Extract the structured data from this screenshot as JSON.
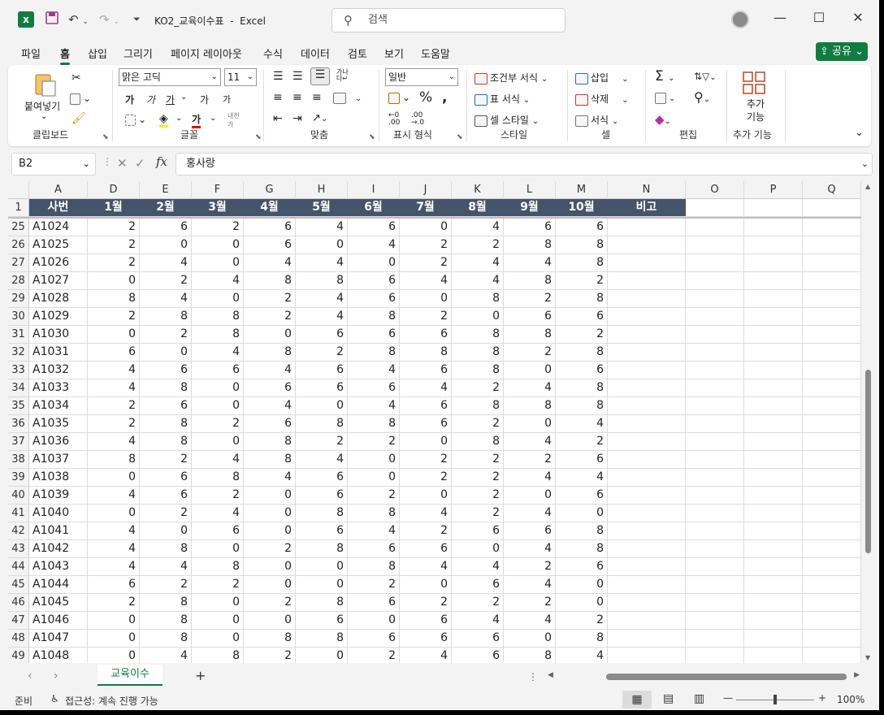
{
  "title_bar": {
    "filename": "KO2_교육이수표",
    "app": "Excel",
    "separator": "-",
    "search_placeholder": "검색"
  },
  "menu_tabs": [
    "파일",
    "홈",
    "삽입",
    "그리기",
    "페이지 레이아웃",
    "수식",
    "데이터",
    "검토",
    "보기",
    "도움말"
  ],
  "active_tab": "홈",
  "share_label": "공유",
  "ribbon": {
    "clipboard": {
      "paste": "붙여넣기",
      "label": "클립보드"
    },
    "font": {
      "name": "맑은 고딕",
      "size": "11",
      "label": "글꼴",
      "bold": "가",
      "italic": "가",
      "underline": "가",
      "grow": "가",
      "shrink": "가",
      "color_letter": "가"
    },
    "alignment": {
      "label": "맞춤"
    },
    "number": {
      "format": "일반",
      "label": "표시 형식"
    },
    "styles": {
      "conditional": "조건부 서식",
      "table": "표 서식",
      "cell": "셀 스타일",
      "label": "스타일"
    },
    "cells": {
      "insert": "삽입",
      "delete": "삭제",
      "format": "서식",
      "label": "셀"
    },
    "editing": {
      "label": "편집"
    },
    "addins": {
      "button": "추가 기능",
      "label": "추가 기능"
    }
  },
  "formula_bar": {
    "name_box": "B2",
    "fx": "fx",
    "value": "홍사랑"
  },
  "columns": [
    "A",
    "D",
    "E",
    "F",
    "G",
    "H",
    "I",
    "J",
    "K",
    "L",
    "M",
    "N",
    "O",
    "P",
    "Q"
  ],
  "header_row": {
    "num": "1",
    "cells": [
      "사번",
      "1월",
      "2월",
      "3월",
      "4월",
      "5월",
      "6월",
      "7월",
      "8월",
      "9월",
      "10월",
      "비고"
    ]
  },
  "rows": [
    {
      "num": "25",
      "id": "A1024",
      "v": [
        "2",
        "6",
        "2",
        "6",
        "4",
        "6",
        "0",
        "4",
        "6",
        "6"
      ]
    },
    {
      "num": "26",
      "id": "A1025",
      "v": [
        "2",
        "0",
        "0",
        "6",
        "0",
        "4",
        "2",
        "2",
        "8",
        "8"
      ]
    },
    {
      "num": "27",
      "id": "A1026",
      "v": [
        "2",
        "4",
        "0",
        "4",
        "4",
        "0",
        "2",
        "4",
        "4",
        "8"
      ]
    },
    {
      "num": "28",
      "id": "A1027",
      "v": [
        "0",
        "2",
        "4",
        "8",
        "8",
        "6",
        "4",
        "4",
        "8",
        "2"
      ]
    },
    {
      "num": "29",
      "id": "A1028",
      "v": [
        "8",
        "4",
        "0",
        "2",
        "4",
        "6",
        "0",
        "8",
        "2",
        "8"
      ]
    },
    {
      "num": "30",
      "id": "A1029",
      "v": [
        "2",
        "8",
        "8",
        "2",
        "4",
        "8",
        "2",
        "0",
        "6",
        "6"
      ]
    },
    {
      "num": "31",
      "id": "A1030",
      "v": [
        "0",
        "2",
        "8",
        "0",
        "6",
        "6",
        "6",
        "8",
        "8",
        "2"
      ]
    },
    {
      "num": "32",
      "id": "A1031",
      "v": [
        "6",
        "0",
        "4",
        "8",
        "2",
        "8",
        "8",
        "8",
        "2",
        "8"
      ]
    },
    {
      "num": "33",
      "id": "A1032",
      "v": [
        "4",
        "6",
        "6",
        "4",
        "6",
        "4",
        "6",
        "8",
        "0",
        "6"
      ]
    },
    {
      "num": "34",
      "id": "A1033",
      "v": [
        "4",
        "8",
        "0",
        "6",
        "6",
        "6",
        "4",
        "2",
        "4",
        "8"
      ]
    },
    {
      "num": "35",
      "id": "A1034",
      "v": [
        "2",
        "6",
        "0",
        "4",
        "0",
        "4",
        "6",
        "8",
        "8",
        "8"
      ]
    },
    {
      "num": "36",
      "id": "A1035",
      "v": [
        "2",
        "8",
        "2",
        "6",
        "8",
        "8",
        "6",
        "2",
        "0",
        "4"
      ]
    },
    {
      "num": "37",
      "id": "A1036",
      "v": [
        "4",
        "8",
        "0",
        "8",
        "2",
        "2",
        "0",
        "8",
        "4",
        "2"
      ]
    },
    {
      "num": "38",
      "id": "A1037",
      "v": [
        "8",
        "2",
        "4",
        "8",
        "4",
        "0",
        "2",
        "2",
        "2",
        "6"
      ]
    },
    {
      "num": "39",
      "id": "A1038",
      "v": [
        "0",
        "6",
        "8",
        "4",
        "6",
        "0",
        "2",
        "2",
        "4",
        "4"
      ]
    },
    {
      "num": "40",
      "id": "A1039",
      "v": [
        "4",
        "6",
        "2",
        "0",
        "6",
        "2",
        "0",
        "2",
        "0",
        "6"
      ]
    },
    {
      "num": "41",
      "id": "A1040",
      "v": [
        "0",
        "2",
        "4",
        "0",
        "8",
        "8",
        "4",
        "2",
        "4",
        "0"
      ]
    },
    {
      "num": "42",
      "id": "A1041",
      "v": [
        "4",
        "0",
        "6",
        "0",
        "6",
        "4",
        "2",
        "6",
        "6",
        "8"
      ]
    },
    {
      "num": "43",
      "id": "A1042",
      "v": [
        "4",
        "8",
        "0",
        "2",
        "8",
        "6",
        "6",
        "0",
        "4",
        "8"
      ]
    },
    {
      "num": "44",
      "id": "A1043",
      "v": [
        "4",
        "4",
        "8",
        "0",
        "0",
        "8",
        "4",
        "4",
        "2",
        "6"
      ]
    },
    {
      "num": "45",
      "id": "A1044",
      "v": [
        "6",
        "2",
        "2",
        "0",
        "0",
        "2",
        "0",
        "6",
        "4",
        "0"
      ]
    },
    {
      "num": "46",
      "id": "A1045",
      "v": [
        "2",
        "8",
        "0",
        "2",
        "8",
        "6",
        "2",
        "2",
        "2",
        "0"
      ]
    },
    {
      "num": "47",
      "id": "A1046",
      "v": [
        "0",
        "8",
        "0",
        "0",
        "6",
        "0",
        "6",
        "4",
        "4",
        "2"
      ]
    },
    {
      "num": "48",
      "id": "A1047",
      "v": [
        "0",
        "8",
        "0",
        "8",
        "8",
        "6",
        "6",
        "6",
        "0",
        "8"
      ]
    },
    {
      "num": "49",
      "id": "A1048",
      "v": [
        "0",
        "4",
        "8",
        "2",
        "0",
        "2",
        "4",
        "6",
        "8",
        "4"
      ]
    }
  ],
  "sheet_tab": "교육이수",
  "status": {
    "ready": "준비",
    "accessibility": "접근성: 계속 진행 가능",
    "zoom": "100%"
  },
  "colors": {
    "accent": "#107c41",
    "header_fill": "#44546a"
  }
}
